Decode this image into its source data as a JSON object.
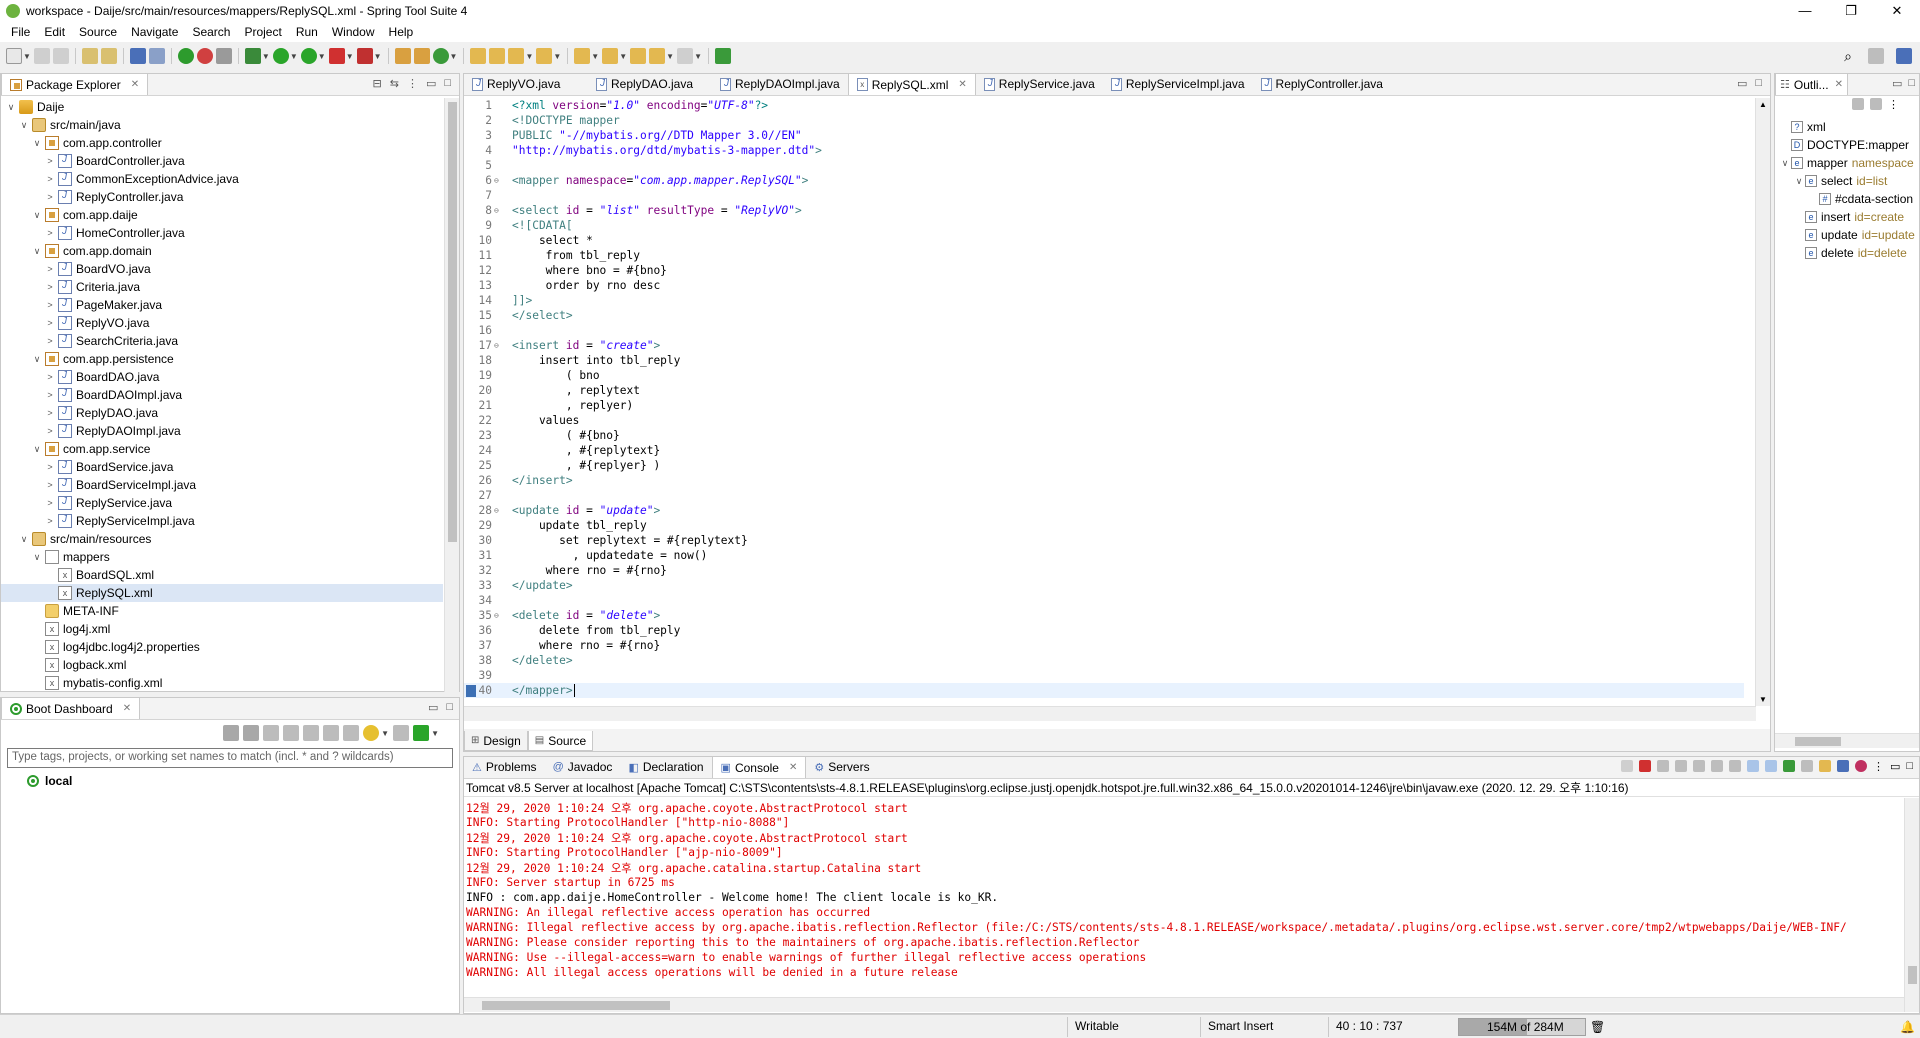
{
  "window": {
    "title": "workspace - Daije/src/main/resources/mappers/ReplySQL.xml - Spring Tool Suite 4",
    "minimize": "—",
    "maximize": "❐",
    "close": "✕"
  },
  "menu": [
    "File",
    "Edit",
    "Source",
    "Navigate",
    "Search",
    "Project",
    "Run",
    "Window",
    "Help"
  ],
  "package_explorer": {
    "tab_label": "Package Explorer",
    "tree": [
      {
        "label": "Daije",
        "indent": 0,
        "twisty": "∨",
        "icon": "proj"
      },
      {
        "label": "src/main/java",
        "indent": 1,
        "twisty": "∨",
        "icon": "srcf"
      },
      {
        "label": "com.app.controller",
        "indent": 2,
        "twisty": "∨",
        "icon": "pkg"
      },
      {
        "label": "BoardController.java",
        "indent": 3,
        "twisty": ">",
        "icon": "java"
      },
      {
        "label": "CommonExceptionAdvice.java",
        "indent": 3,
        "twisty": ">",
        "icon": "java"
      },
      {
        "label": "ReplyController.java",
        "indent": 3,
        "twisty": ">",
        "icon": "java"
      },
      {
        "label": "com.app.daije",
        "indent": 2,
        "twisty": "∨",
        "icon": "pkg"
      },
      {
        "label": "HomeController.java",
        "indent": 3,
        "twisty": ">",
        "icon": "java"
      },
      {
        "label": "com.app.domain",
        "indent": 2,
        "twisty": "∨",
        "icon": "pkg"
      },
      {
        "label": "BoardVO.java",
        "indent": 3,
        "twisty": ">",
        "icon": "java"
      },
      {
        "label": "Criteria.java",
        "indent": 3,
        "twisty": ">",
        "icon": "java"
      },
      {
        "label": "PageMaker.java",
        "indent": 3,
        "twisty": ">",
        "icon": "java"
      },
      {
        "label": "ReplyVO.java",
        "indent": 3,
        "twisty": ">",
        "icon": "java"
      },
      {
        "label": "SearchCriteria.java",
        "indent": 3,
        "twisty": ">",
        "icon": "java"
      },
      {
        "label": "com.app.persistence",
        "indent": 2,
        "twisty": "∨",
        "icon": "pkg"
      },
      {
        "label": "BoardDAO.java",
        "indent": 3,
        "twisty": ">",
        "icon": "java"
      },
      {
        "label": "BoardDAOImpl.java",
        "indent": 3,
        "twisty": ">",
        "icon": "java"
      },
      {
        "label": "ReplyDAO.java",
        "indent": 3,
        "twisty": ">",
        "icon": "java"
      },
      {
        "label": "ReplyDAOImpl.java",
        "indent": 3,
        "twisty": ">",
        "icon": "java"
      },
      {
        "label": "com.app.service",
        "indent": 2,
        "twisty": "∨",
        "icon": "pkg"
      },
      {
        "label": "BoardService.java",
        "indent": 3,
        "twisty": ">",
        "icon": "java"
      },
      {
        "label": "BoardServiceImpl.java",
        "indent": 3,
        "twisty": ">",
        "icon": "java"
      },
      {
        "label": "ReplyService.java",
        "indent": 3,
        "twisty": ">",
        "icon": "java"
      },
      {
        "label": "ReplyServiceImpl.java",
        "indent": 3,
        "twisty": ">",
        "icon": "java"
      },
      {
        "label": "src/main/resources",
        "indent": 1,
        "twisty": "∨",
        "icon": "srcf"
      },
      {
        "label": "mappers",
        "indent": 2,
        "twisty": "∨",
        "icon": "fold2"
      },
      {
        "label": "BoardSQL.xml",
        "indent": 3,
        "twisty": "",
        "icon": "xml"
      },
      {
        "label": "ReplySQL.xml",
        "indent": 3,
        "twisty": "",
        "icon": "xml",
        "selected": true
      },
      {
        "label": "META-INF",
        "indent": 2,
        "twisty": "",
        "icon": "folder"
      },
      {
        "label": "log4j.xml",
        "indent": 2,
        "twisty": "",
        "icon": "xml"
      },
      {
        "label": "log4jdbc.log4j2.properties",
        "indent": 2,
        "twisty": "",
        "icon": "xml"
      },
      {
        "label": "logback.xml",
        "indent": 2,
        "twisty": "",
        "icon": "xml"
      },
      {
        "label": "mybatis-config.xml",
        "indent": 2,
        "twisty": "",
        "icon": "xml"
      }
    ]
  },
  "boot_dashboard": {
    "tab_label": "Boot Dashboard",
    "filter_placeholder": "Type tags, projects, or working set names to match (incl. * and ? wildcards)",
    "local": "local"
  },
  "editor": {
    "tabs": [
      "ReplyVO.java",
      "ReplyDAO.java",
      "ReplyDAOImpl.java",
      "ReplySQL.xml",
      "ReplyService.java",
      "ReplyServiceImpl.java",
      "ReplyController.java"
    ],
    "active_tab": "ReplySQL.xml",
    "bottom_tabs": [
      "Design",
      "Source"
    ],
    "lines": [
      {
        "n": "1",
        "parts": [
          [
            "t-decl",
            "<?xml "
          ],
          [
            "t-attr",
            "version"
          ],
          [
            "t-plain",
            "="
          ],
          [
            "t-val",
            "\"1.0\""
          ],
          [
            "t-plain",
            " "
          ],
          [
            "t-attr",
            "encoding"
          ],
          [
            "t-plain",
            "="
          ],
          [
            "t-val",
            "\"UTF-8\""
          ],
          [
            "t-decl",
            "?>"
          ]
        ]
      },
      {
        "n": "2",
        "parts": [
          [
            "t-tag",
            "<!DOCTYPE mapper"
          ]
        ]
      },
      {
        "n": "3",
        "parts": [
          [
            "t-tag",
            "PUBLIC "
          ],
          [
            "t-dtdv",
            "\"-//mybatis.org//DTD Mapper 3.0//EN\""
          ]
        ]
      },
      {
        "n": "4",
        "parts": [
          [
            "t-dtdv",
            "\"http://mybatis.org/dtd/mybatis-3-mapper.dtd\""
          ],
          [
            "t-tag",
            ">"
          ]
        ]
      },
      {
        "n": "5",
        "parts": []
      },
      {
        "n": "6",
        "fold": "⊖",
        "parts": [
          [
            "t-tag",
            "<mapper "
          ],
          [
            "t-attr",
            "namespace"
          ],
          [
            "t-plain",
            "="
          ],
          [
            "t-val",
            "\"com.app.mapper.ReplySQL\""
          ],
          [
            "t-tag",
            ">"
          ]
        ]
      },
      {
        "n": "7",
        "parts": []
      },
      {
        "n": "8",
        "fold": "⊖",
        "parts": [
          [
            "t-tag",
            "<select "
          ],
          [
            "t-attr",
            "id"
          ],
          [
            "t-plain",
            " = "
          ],
          [
            "t-val",
            "\"list\""
          ],
          [
            "t-plain",
            " "
          ],
          [
            "t-attr",
            "resultType"
          ],
          [
            "t-plain",
            " = "
          ],
          [
            "t-val",
            "\"ReplyVO\""
          ],
          [
            "t-tag",
            ">"
          ]
        ]
      },
      {
        "n": "9",
        "parts": [
          [
            "t-cdata",
            "<![CDATA["
          ]
        ]
      },
      {
        "n": "10",
        "parts": [
          [
            "t-plain",
            "    select *"
          ]
        ]
      },
      {
        "n": "11",
        "parts": [
          [
            "t-plain",
            "     from tbl_reply"
          ]
        ]
      },
      {
        "n": "12",
        "parts": [
          [
            "t-plain",
            "     where bno = #{bno}"
          ]
        ]
      },
      {
        "n": "13",
        "parts": [
          [
            "t-plain",
            "     order by rno desc"
          ]
        ]
      },
      {
        "n": "14",
        "parts": [
          [
            "t-cdata",
            "]]>"
          ]
        ]
      },
      {
        "n": "15",
        "parts": [
          [
            "t-tag",
            "</select>"
          ]
        ]
      },
      {
        "n": "16",
        "parts": []
      },
      {
        "n": "17",
        "fold": "⊖",
        "parts": [
          [
            "t-tag",
            "<insert "
          ],
          [
            "t-attr",
            "id"
          ],
          [
            "t-plain",
            " = "
          ],
          [
            "t-val",
            "\"create\""
          ],
          [
            "t-tag",
            ">"
          ]
        ]
      },
      {
        "n": "18",
        "parts": [
          [
            "t-plain",
            "    insert into tbl_reply"
          ]
        ]
      },
      {
        "n": "19",
        "parts": [
          [
            "t-plain",
            "        ( bno"
          ]
        ]
      },
      {
        "n": "20",
        "parts": [
          [
            "t-plain",
            "        , replytext"
          ]
        ]
      },
      {
        "n": "21",
        "parts": [
          [
            "t-plain",
            "        , replyer)"
          ]
        ]
      },
      {
        "n": "22",
        "parts": [
          [
            "t-plain",
            "    values"
          ]
        ]
      },
      {
        "n": "23",
        "parts": [
          [
            "t-plain",
            "        ( #{bno}"
          ]
        ]
      },
      {
        "n": "24",
        "parts": [
          [
            "t-plain",
            "        , #{replytext}"
          ]
        ]
      },
      {
        "n": "25",
        "parts": [
          [
            "t-plain",
            "        , #{replyer} )"
          ]
        ]
      },
      {
        "n": "26",
        "parts": [
          [
            "t-tag",
            "</insert>"
          ]
        ]
      },
      {
        "n": "27",
        "parts": []
      },
      {
        "n": "28",
        "fold": "⊖",
        "parts": [
          [
            "t-tag",
            "<update "
          ],
          [
            "t-attr",
            "id"
          ],
          [
            "t-plain",
            " = "
          ],
          [
            "t-val",
            "\"update\""
          ],
          [
            "t-tag",
            ">"
          ]
        ]
      },
      {
        "n": "29",
        "parts": [
          [
            "t-plain",
            "    update tbl_reply"
          ]
        ]
      },
      {
        "n": "30",
        "parts": [
          [
            "t-plain",
            "       set replytext = #{replytext}"
          ]
        ]
      },
      {
        "n": "31",
        "parts": [
          [
            "t-plain",
            "         , updatedate = now()"
          ]
        ]
      },
      {
        "n": "32",
        "parts": [
          [
            "t-plain",
            "     where rno = #{rno}"
          ]
        ]
      },
      {
        "n": "33",
        "parts": [
          [
            "t-tag",
            "</update>"
          ]
        ]
      },
      {
        "n": "34",
        "parts": []
      },
      {
        "n": "35",
        "fold": "⊖",
        "parts": [
          [
            "t-tag",
            "<delete "
          ],
          [
            "t-attr",
            "id"
          ],
          [
            "t-plain",
            " = "
          ],
          [
            "t-val",
            "\"delete\""
          ],
          [
            "t-tag",
            ">"
          ]
        ]
      },
      {
        "n": "36",
        "parts": [
          [
            "t-plain",
            "    delete from tbl_reply"
          ]
        ]
      },
      {
        "n": "37",
        "parts": [
          [
            "t-plain",
            "    where rno = #{rno}"
          ]
        ]
      },
      {
        "n": "38",
        "parts": [
          [
            "t-tag",
            "</delete>"
          ]
        ]
      },
      {
        "n": "39",
        "parts": []
      },
      {
        "n": "40",
        "current": true,
        "parts": [
          [
            "t-tag",
            "</mapper>"
          ]
        ]
      }
    ]
  },
  "outline": {
    "tab_label": "Outli...",
    "items": [
      {
        "indent": 0,
        "twisty": "",
        "icon": "?",
        "label": "xml",
        "attr": ""
      },
      {
        "indent": 0,
        "twisty": "",
        "icon": "D",
        "label": "DOCTYPE:mapper",
        "attr": ""
      },
      {
        "indent": 0,
        "twisty": "∨",
        "icon": "e",
        "label": "mapper",
        "attr": "namespace"
      },
      {
        "indent": 1,
        "twisty": "∨",
        "icon": "e",
        "label": "select",
        "attr": "id=list"
      },
      {
        "indent": 2,
        "twisty": "",
        "icon": "#",
        "label": "#cdata-section",
        "attr": ""
      },
      {
        "indent": 1,
        "twisty": "",
        "icon": "e",
        "label": "insert",
        "attr": "id=create"
      },
      {
        "indent": 1,
        "twisty": "",
        "icon": "e",
        "label": "update",
        "attr": "id=update"
      },
      {
        "indent": 1,
        "twisty": "",
        "icon": "e",
        "label": "delete",
        "attr": "id=delete"
      }
    ]
  },
  "console": {
    "tabs": [
      "Problems",
      "Javadoc",
      "Declaration",
      "Console",
      "Servers"
    ],
    "active_tab": "Console",
    "description": "Tomcat v8.5 Server at localhost [Apache Tomcat] C:\\STS\\contents\\sts-4.8.1.RELEASE\\plugins\\org.eclipse.justj.openjdk.hotspot.jre.full.win32.x86_64_15.0.0.v20201014-1246\\jre\\bin\\javaw.exe  (2020. 12. 29. 오후 1:10:16)",
    "lines": [
      {
        "kind": "err",
        "text": "12월 29, 2020 1:10:24 오후 org.apache.coyote.AbstractProtocol start"
      },
      {
        "kind": "err",
        "text": "INFO: Starting ProtocolHandler [\"http-nio-8088\"]"
      },
      {
        "kind": "err",
        "text": "12월 29, 2020 1:10:24 오후 org.apache.coyote.AbstractProtocol start"
      },
      {
        "kind": "err",
        "text": "INFO: Starting ProtocolHandler [\"ajp-nio-8009\"]"
      },
      {
        "kind": "err",
        "text": "12월 29, 2020 1:10:24 오후 org.apache.catalina.startup.Catalina start"
      },
      {
        "kind": "err",
        "text": "INFO: Server startup in 6725 ms"
      },
      {
        "kind": "std",
        "text": "INFO : com.app.daije.HomeController - Welcome home! The client locale is ko_KR."
      },
      {
        "kind": "err",
        "text": "WARNING: An illegal reflective access operation has occurred"
      },
      {
        "kind": "err",
        "text": "WARNING: Illegal reflective access by org.apache.ibatis.reflection.Reflector (file:/C:/STS/contents/sts-4.8.1.RELEASE/workspace/.metadata/.plugins/org.eclipse.wst.server.core/tmp2/wtpwebapps/Daije/WEB-INF/"
      },
      {
        "kind": "err",
        "text": "WARNING: Please consider reporting this to the maintainers of org.apache.ibatis.reflection.Reflector"
      },
      {
        "kind": "err",
        "text": "WARNING: Use --illegal-access=warn to enable warnings of further illegal reflective access operations"
      },
      {
        "kind": "err",
        "text": "WARNING: All illegal access operations will be denied in a future release"
      }
    ]
  },
  "status": {
    "writable": "Writable",
    "insert_mode": "Smart Insert",
    "position": "40 : 10 : 737",
    "heap": "154M of 284M",
    "heap_used_fraction": 0.54
  },
  "colors": {
    "tag": "#3f7f7f",
    "attr": "#7f007f",
    "value": "#2a00ff",
    "console_error": "#e00000",
    "selection": "#dbe6f5"
  }
}
